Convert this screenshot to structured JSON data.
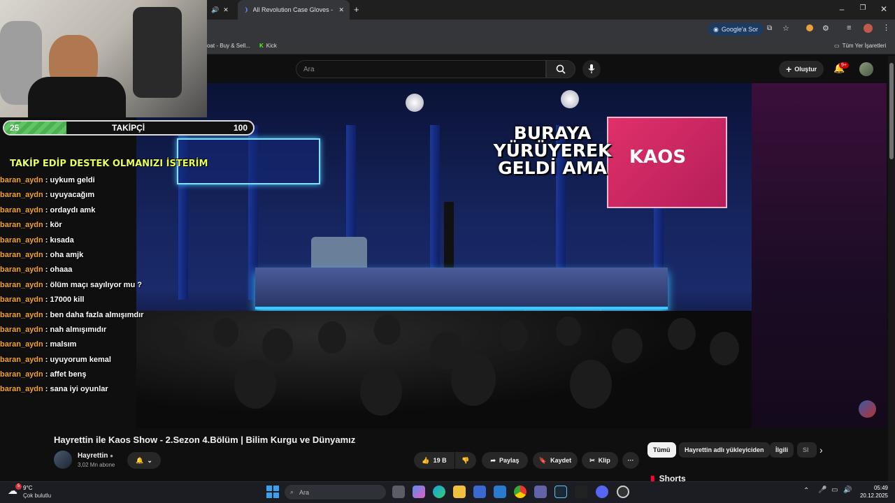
{
  "browser": {
    "active_tab_title": "All Revolution Case Gloves - CS",
    "ask_google": "Google'a Sor",
    "bookmarks": [
      "oat - Buy & Sell...",
      "Kick"
    ],
    "all_bookmarks": "Tüm Yer İşaretleri"
  },
  "youtube": {
    "search_placeholder": "Ara",
    "create_label": "Oluştur",
    "notification_count": "9+"
  },
  "video": {
    "overlay_text": "BURAYA YÜRÜYEREK GELDİ AMA",
    "title": "Hayrettin ile Kaos Show - 2.Sezon 4.Bölüm | Bilim Kurgu ve Dünyamız",
    "channel": "Hayrettin",
    "subscribers": "3,02 Mn abone",
    "likes": "19 B",
    "share_label": "Paylaş",
    "save_label": "Kaydet",
    "clip_label": "Klip"
  },
  "chips": [
    "Tümü",
    "Hayrettin adlı yükleyiciden",
    "İlgili",
    "Sl"
  ],
  "shorts_label": "Shorts",
  "stream": {
    "follower_current": "25",
    "follower_label": "TAKİPÇİ",
    "follower_goal": "100",
    "follower_progress": 0.25,
    "banner": "TAKİP EDİP DESTEK OLMANIZI İSTERİM",
    "chat": [
      {
        "user": "baran_aydn",
        "msg": "uykum geldi"
      },
      {
        "user": "baran_aydn",
        "msg": "uyuyacağım"
      },
      {
        "user": "baran_aydn",
        "msg": "ordaydı amk"
      },
      {
        "user": "baran_aydn",
        "msg": "kör"
      },
      {
        "user": "baran_aydn",
        "msg": "kısada"
      },
      {
        "user": "baran_aydn",
        "msg": "oha amjk"
      },
      {
        "user": "baran_aydn",
        "msg": "ohaaa"
      },
      {
        "user": "baran_aydn",
        "msg": "ölüm maçı sayılıyor mu ?"
      },
      {
        "user": "baran_aydn",
        "msg": "17000 kill"
      },
      {
        "user": "baran_aydn",
        "msg": "ben daha fazla almışımdır"
      },
      {
        "user": "baran_aydn",
        "msg": "nah almışımıdır"
      },
      {
        "user": "baran_aydn",
        "msg": "malsım"
      },
      {
        "user": "baran_aydn",
        "msg": "uyuyorum kemal"
      },
      {
        "user": "baran_aydn",
        "msg": "affet benş"
      },
      {
        "user": "baran_aydn",
        "msg": "sana iyi oyunlar"
      }
    ]
  },
  "taskbar": {
    "weather_temp": "9°C",
    "weather_desc": "Çok bulutlu",
    "weather_badge": "5",
    "search_placeholder": "Ara",
    "time": "05:49",
    "date": "20.12.2025"
  },
  "colors": {
    "chat_user": "#f4a52c",
    "banner": "#e8ff5a",
    "progress_fill": "#4caf50",
    "notif_badge": "#cc0000"
  }
}
